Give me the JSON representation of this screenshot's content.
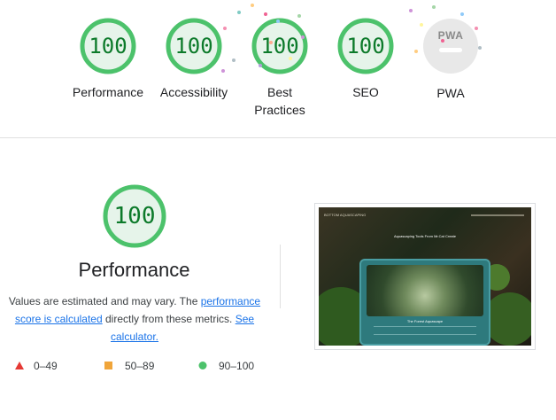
{
  "categories": [
    {
      "label_lines": [
        "Performance"
      ],
      "score": "100"
    },
    {
      "label_lines": [
        "Accessibility"
      ],
      "score": "100"
    },
    {
      "label_lines": [
        "Best",
        "Practices"
      ],
      "score": "100"
    },
    {
      "label_lines": [
        "SEO"
      ],
      "score": "100"
    }
  ],
  "pwa": {
    "label": "PWA",
    "badge_text": "PWA"
  },
  "main": {
    "score": "100",
    "score_fraction": 1.0,
    "title": "Performance",
    "desc_part1": "Values are estimated and may vary. The ",
    "desc_link1": "performance score is calculated",
    "desc_part2": " directly from these metrics. ",
    "desc_link2": "See calculator."
  },
  "legend": [
    {
      "range": "0–49",
      "color": "#e53935",
      "shape": "triangle"
    },
    {
      "range": "50–89",
      "color": "#f0a53a",
      "shape": "square"
    },
    {
      "range": "90–100",
      "color": "#4cc26b",
      "shape": "circle"
    }
  ],
  "screenshot": {
    "nav_text": "BOTTOM AQUASCAPING",
    "title_text": "Aquascaping Tools From Mr.Cat Create",
    "card_title": "The Forest Aquascape"
  },
  "colors": {
    "pass": "#0c7a2a",
    "pass_ring": "#4cc26b",
    "pass_fill": "#e6f4ea",
    "link": "#1a73e8"
  }
}
